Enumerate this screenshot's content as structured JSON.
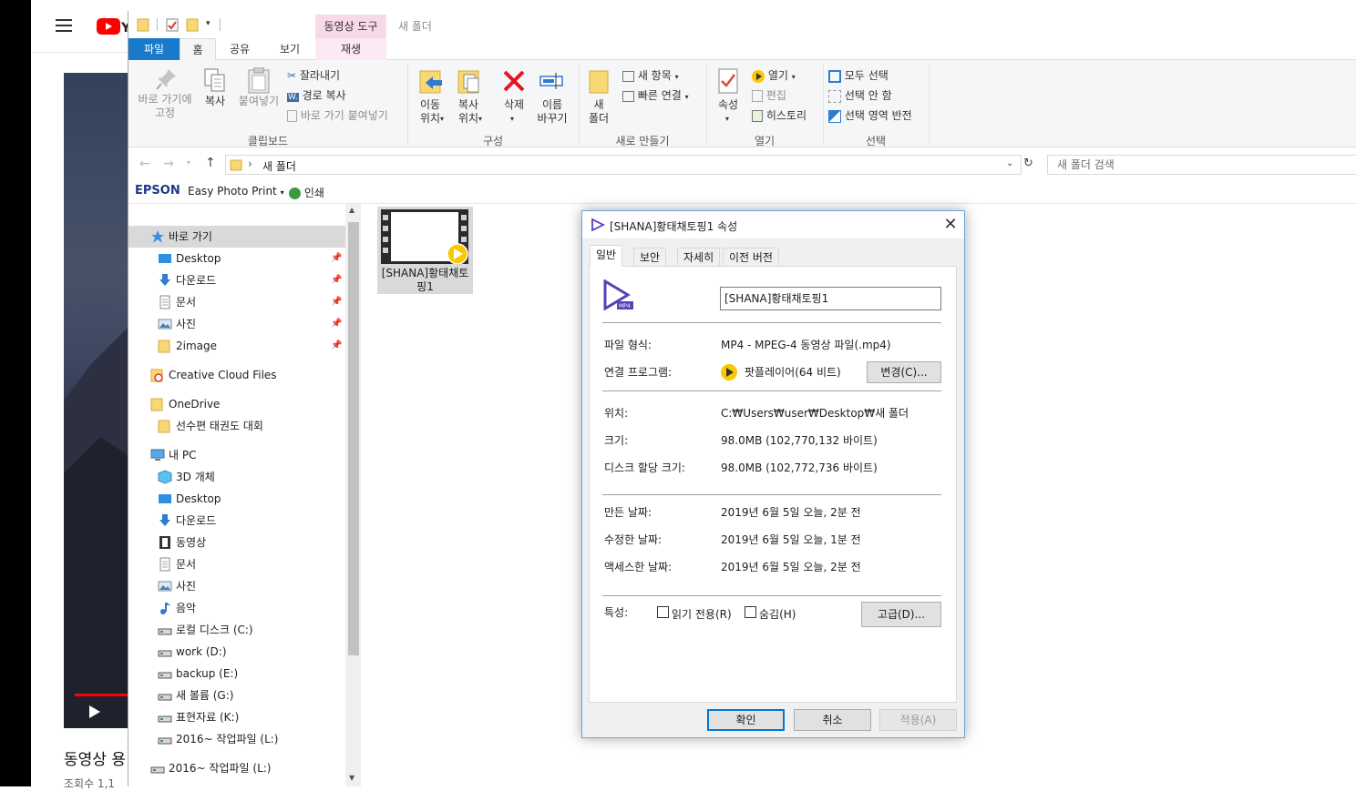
{
  "background": {
    "yt_title": "동영상 용",
    "yt_sub": "조회수 1,1"
  },
  "explorer": {
    "ribbon_context_tab": "동영상 도구",
    "window_title": "새 폴더",
    "tabs": [
      "파일",
      "홈",
      "공유",
      "보기",
      "재생"
    ],
    "ribbon": {
      "pin_label": "바로 가기에\n고정",
      "copy_label": "복사",
      "paste_label": "붙여넣기",
      "cut_label": "잘라내기",
      "copy_path_label": "경로 복사",
      "paste_shortcut_label": "바로 가기 붙여넣기",
      "clipboard_group": "클립보드",
      "move_to_label": "이동\n위치",
      "copy_to_label": "복사\n위치",
      "delete_label": "삭제",
      "rename_label": "이름\n바꾸기",
      "organize_group": "구성",
      "new_folder_label": "새\n폴더",
      "new_item_label": "새 항목",
      "easy_access_label": "빠른 연결",
      "new_group": "새로 만들기",
      "properties_label": "속성",
      "open_label": "열기",
      "edit_label": "편집",
      "history_label": "히스토리",
      "open_group": "열기",
      "select_all_label": "모두 선택",
      "select_none_label": "선택 안 함",
      "invert_selection_label": "선택 영역 반전",
      "select_group": "선택"
    },
    "address": {
      "path": "새 폴더",
      "search_placeholder": "새 폴더 검색"
    },
    "epson": {
      "brand": "EPSON",
      "app": "Easy Photo Print",
      "print": "인쇄"
    },
    "nav": [
      {
        "label": "바로 가기",
        "icon": "star-icon",
        "indent": 0,
        "pinned": false,
        "selected": true
      },
      {
        "label": "Desktop",
        "icon": "desktop-icon",
        "indent": 1,
        "pinned": true
      },
      {
        "label": "다운로드",
        "icon": "download-icon",
        "indent": 1,
        "pinned": true
      },
      {
        "label": "문서",
        "icon": "document-icon",
        "indent": 1,
        "pinned": true
      },
      {
        "label": "사진",
        "icon": "picture-icon",
        "indent": 1,
        "pinned": true
      },
      {
        "label": "2image",
        "icon": "folder-icon",
        "indent": 1,
        "pinned": true
      },
      {
        "label": "Creative Cloud Files",
        "icon": "creative-cloud-icon",
        "indent": 0
      },
      {
        "label": "OneDrive",
        "icon": "folder-icon",
        "indent": 0
      },
      {
        "label": "선수편 태권도 대회",
        "icon": "folder-icon",
        "indent": 1
      },
      {
        "label": "내 PC",
        "icon": "pc-icon",
        "indent": 0
      },
      {
        "label": "3D 개체",
        "icon": "cube-icon",
        "indent": 1
      },
      {
        "label": "Desktop",
        "icon": "desktop-icon",
        "indent": 1
      },
      {
        "label": "다운로드",
        "icon": "download-icon",
        "indent": 1
      },
      {
        "label": "동영상",
        "icon": "video-icon",
        "indent": 1
      },
      {
        "label": "문서",
        "icon": "document-icon",
        "indent": 1
      },
      {
        "label": "사진",
        "icon": "picture-icon",
        "indent": 1
      },
      {
        "label": "음악",
        "icon": "music-icon",
        "indent": 1
      },
      {
        "label": "로컬 디스크 (C:)",
        "icon": "drive-icon",
        "indent": 1
      },
      {
        "label": "work  (D:)",
        "icon": "drive-icon",
        "indent": 1
      },
      {
        "label": "backup (E:)",
        "icon": "drive-icon",
        "indent": 1
      },
      {
        "label": "새 볼륨 (G:)",
        "icon": "drive-icon",
        "indent": 1
      },
      {
        "label": "표현자료 (K:)",
        "icon": "drive-icon",
        "indent": 1
      },
      {
        "label": "2016~ 작업파일 (L:)",
        "icon": "drive-icon",
        "indent": 1
      },
      {
        "label": "2016~ 작업파일 (L:)",
        "icon": "drive-icon",
        "indent": 0
      }
    ],
    "file": {
      "name": "[SHANA]황태채토핑1"
    }
  },
  "dialog": {
    "title": "[SHANA]황태채토핑1 속성",
    "tabs": [
      "일반",
      "보안",
      "자세히",
      "이전 버전"
    ],
    "filename": "[SHANA]황태채토핑1",
    "file_type_label": "파일 형식:",
    "file_type_value": "MP4 - MPEG-4 동영상 파일(.mp4)",
    "opens_with_label": "연결 프로그램:",
    "opens_with_value": "팟플레이어(64 비트)",
    "change_button": "변경(C)...",
    "location_label": "위치:",
    "location_value": "C:₩Users₩user₩Desktop₩새 폴더",
    "size_label": "크기:",
    "size_value": "98.0MB (102,770,132 바이트)",
    "size_on_disk_label": "디스크 할당 크기:",
    "size_on_disk_value": "98.0MB (102,772,736 바이트)",
    "created_label": "만든 날짜:",
    "created_value": "2019년 6월 5일 오늘, 2분 전",
    "modified_label": "수정한 날짜:",
    "modified_value": "2019년 6월 5일 오늘, 1분 전",
    "accessed_label": "액세스한 날짜:",
    "accessed_value": "2019년 6월 5일 오늘, 2분 전",
    "attributes_label": "특성:",
    "readonly_label": "읽기 전용(R)",
    "hidden_label": "숨김(H)",
    "advanced_button": "고급(D)...",
    "ok_button": "확인",
    "cancel_button": "취소",
    "apply_button": "적용(A)"
  }
}
